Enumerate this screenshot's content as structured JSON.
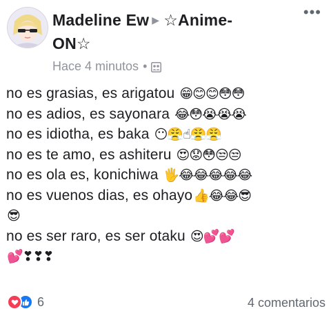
{
  "post": {
    "author": "Madeline Ew",
    "group_line1": "☆Anime-",
    "group_line2": "ON☆",
    "timestamp": "Hace 4 minutos",
    "audience_icon": "group-audience-icon",
    "more_label": "•••"
  },
  "body": {
    "lines": [
      {
        "text": "no es grasias, es arigatou ",
        "emoji": "😁😊😊😳😳"
      },
      {
        "text": "no es adios, es sayonara ",
        "emoji": "😂😳😭😭😭"
      },
      {
        "text": "no es idiotha, es baka ",
        "emoji": "😶😤☝😤😤"
      },
      {
        "text": "no es te amo, es ashiteru ",
        "emoji": "😍😟😳😒😒"
      },
      {
        "text": "no es ola es, konichiwa ",
        "emoji": "🖐😂😂😂😂😂"
      },
      {
        "text": "no es vuenos dias, es ohayo",
        "emoji": "👍😂😂😎"
      },
      {
        "text": "",
        "emoji": "😎"
      },
      {
        "text": "no es ser raro, es ser otaku ",
        "emoji": "😍💕💕"
      },
      {
        "text": "",
        "emoji": "💕❣❣❣"
      }
    ]
  },
  "footer": {
    "reaction_icons": [
      "love-reaction-icon",
      "like-reaction-icon"
    ],
    "reaction_count": "6",
    "comments_label": "4 comentarios"
  },
  "colors": {
    "author": "#1c1e21",
    "meta": "#90949c",
    "love": "#f33e58",
    "like": "#1877f2"
  }
}
